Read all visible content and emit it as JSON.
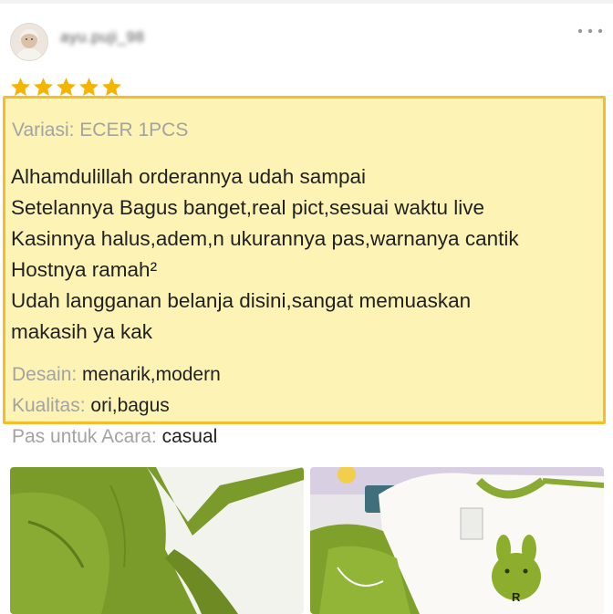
{
  "review": {
    "username": "ayu.puji_98",
    "more_icon": "more-dots-icon",
    "rating": 5,
    "max_rating": 5,
    "star_color": "#f4b400",
    "highlight_fill": "#fcf3b4",
    "highlight_border": "#f4be2a",
    "variation": "Variasi: ECER 1PCS",
    "text_lines": [
      "Alhamdulillah orderannya udah sampai",
      "Setelannya Bagus banget,real pict,sesuai waktu live",
      "Kasinnya halus,adem,n ukurannya pas,warnanya cantik",
      "Hostnya ramah²",
      "Udah langganan belanja disini,sangat memuaskan",
      "makasih ya kak"
    ],
    "attributes": [
      {
        "label": "Desain:",
        "value": "menarik,modern"
      },
      {
        "label": "Kualitas:",
        "value": "ori,bagus"
      },
      {
        "label": "Pas untuk Acara:",
        "value": "casual"
      }
    ],
    "photos": [
      "photo-green-pants",
      "photo-bunny-shirt-set"
    ]
  }
}
